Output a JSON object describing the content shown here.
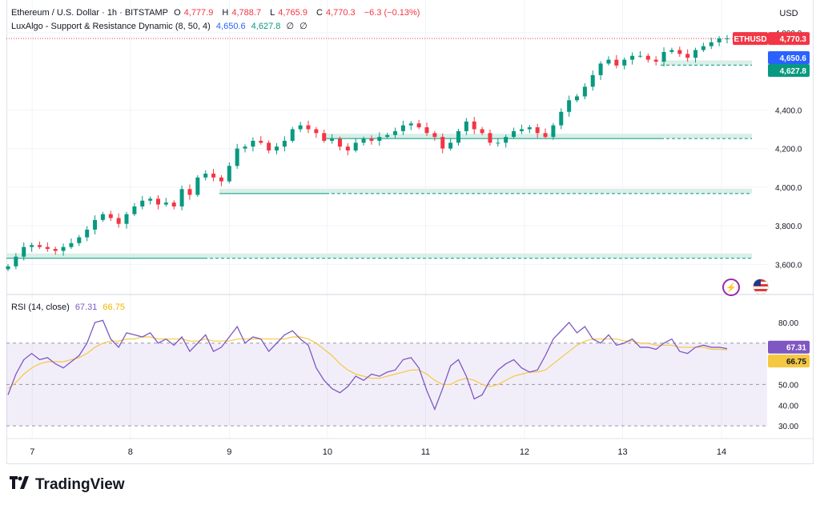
{
  "header": {
    "symbol_line": "Ethereum / U.S. Dollar · 1h · BITSTAMP",
    "open_label": "O",
    "open": "4,777.9",
    "high_label": "H",
    "high": "4,788.7",
    "low_label": "L",
    "low": "4,765.9",
    "close_label": "C",
    "close": "4,770.3",
    "change": "−6.3 (−0.13%)",
    "indicator_name": "LuxAlgo - Support & Resistance Dynamic (8, 50, 4)",
    "indicator_value_1": "4,650.6",
    "indicator_value_2": "4,627.8",
    "indicator_value_3": "∅",
    "indicator_value_4": "∅",
    "currency_button": "USD"
  },
  "price_tags": {
    "symbol": "ETHUSD",
    "last": "4,770.3",
    "resistance": "4,650.6",
    "support": "4,627.8"
  },
  "rsi_legend": {
    "label": "RSI (14, close)",
    "rsi_value": "67.31",
    "ma_value": "66.75"
  },
  "brand": {
    "logo_text": "TradingView"
  },
  "icons": {
    "lightning": "lightning-icon",
    "flag": "us-flag-icon",
    "logo": "tradingview-logo-icon"
  },
  "colors": {
    "up": "#089981",
    "down": "#f23645",
    "rsi": "#7e57c2",
    "rsi_ma": "#f5c842",
    "band": "#d9efe8"
  },
  "chart_data": [
    {
      "type": "candlestick",
      "title": "Ethereum / U.S. Dollar · 1h · BITSTAMP",
      "y_ticks": [
        "4,800.0",
        "4,400.0",
        "4,200.0",
        "4,000.0",
        "3,800.0",
        "3,600.0"
      ],
      "x_ticks": [
        "7",
        "8",
        "9",
        "10",
        "11",
        "12",
        "13",
        "14"
      ],
      "ylim": [
        3560,
        4820
      ],
      "x": [
        0,
        2,
        4,
        6,
        8,
        10,
        12,
        14,
        16,
        18,
        20,
        22,
        24,
        26,
        28,
        30,
        32,
        34,
        36,
        38,
        40,
        42,
        44,
        46,
        48,
        50,
        52,
        54,
        56,
        58,
        60,
        62,
        64,
        66,
        68,
        70,
        72,
        74,
        76,
        78,
        80,
        82,
        84,
        86,
        88,
        90,
        92,
        94,
        96,
        98,
        100,
        102,
        104,
        106,
        108,
        110,
        112,
        114,
        116,
        118,
        120,
        122,
        124,
        126,
        128,
        130,
        132,
        134,
        136,
        138,
        140,
        142,
        144,
        146,
        148,
        150,
        152,
        154,
        156,
        158,
        160,
        162,
        164,
        166,
        168,
        170,
        172,
        174,
        176,
        178,
        180,
        182
      ],
      "close": [
        3590,
        3640,
        3690,
        3700,
        3690,
        3680,
        3670,
        3690,
        3710,
        3740,
        3780,
        3830,
        3860,
        3840,
        3810,
        3860,
        3900,
        3930,
        3940,
        3910,
        3920,
        3900,
        3990,
        3960,
        4050,
        4070,
        4050,
        4030,
        4110,
        4200,
        4210,
        4240,
        4230,
        4190,
        4210,
        4240,
        4300,
        4320,
        4300,
        4280,
        4240,
        4250,
        4210,
        4190,
        4230,
        4250,
        4240,
        4260,
        4270,
        4290,
        4320,
        4330,
        4310,
        4280,
        4260,
        4200,
        4230,
        4290,
        4340,
        4300,
        4280,
        4230,
        4230,
        4260,
        4290,
        4300,
        4310,
        4280,
        4260,
        4320,
        4390,
        4450,
        4470,
        4520,
        4580,
        4640,
        4660,
        4630,
        4660,
        4680,
        4680,
        4660,
        4650,
        4700,
        4710,
        4690,
        4670,
        4710,
        4730,
        4750,
        4770,
        4770
      ],
      "rsi_ylim": [
        25,
        85
      ],
      "rsi_ticks": [
        "80.00",
        "50.00",
        "40.00",
        "30.00"
      ],
      "rsi": [
        45,
        55,
        62,
        65,
        62,
        63,
        60,
        58,
        61,
        64,
        70,
        80,
        81,
        72,
        68,
        75,
        74,
        73,
        75,
        70,
        72,
        69,
        73,
        66,
        70,
        74,
        66,
        68,
        73,
        78,
        70,
        73,
        72,
        66,
        70,
        74,
        76,
        72,
        69,
        58,
        52,
        48,
        46,
        49,
        54,
        52,
        55,
        54,
        56,
        57,
        62,
        63,
        58,
        47,
        38,
        48,
        59,
        62,
        54,
        43,
        45,
        52,
        57,
        60,
        62,
        58,
        56,
        57,
        64,
        72,
        76,
        80,
        75,
        78,
        72,
        70,
        74,
        69,
        70,
        72,
        68,
        68,
        67,
        70,
        72,
        66,
        65,
        68,
        69,
        68,
        68,
        67.31
      ],
      "rsi_ma": [
        48,
        51,
        55,
        58,
        60,
        61,
        61,
        61,
        62,
        63,
        65,
        68,
        70,
        71,
        71,
        72,
        72,
        73,
        73,
        72,
        72,
        72,
        72,
        71,
        71,
        72,
        71,
        71,
        71,
        72,
        72,
        72,
        72,
        72,
        72,
        72,
        73,
        73,
        72,
        70,
        67,
        64,
        60,
        57,
        55,
        54,
        53,
        53,
        54,
        55,
        56,
        57,
        57,
        55,
        52,
        50,
        50,
        52,
        53,
        52,
        50,
        49,
        50,
        52,
        54,
        55,
        56,
        56,
        57,
        60,
        63,
        66,
        69,
        71,
        72,
        72,
        72,
        72,
        71,
        71,
        70,
        70,
        69,
        69,
        69,
        68,
        68,
        68,
        68,
        67,
        67,
        66.75
      ]
    }
  ]
}
